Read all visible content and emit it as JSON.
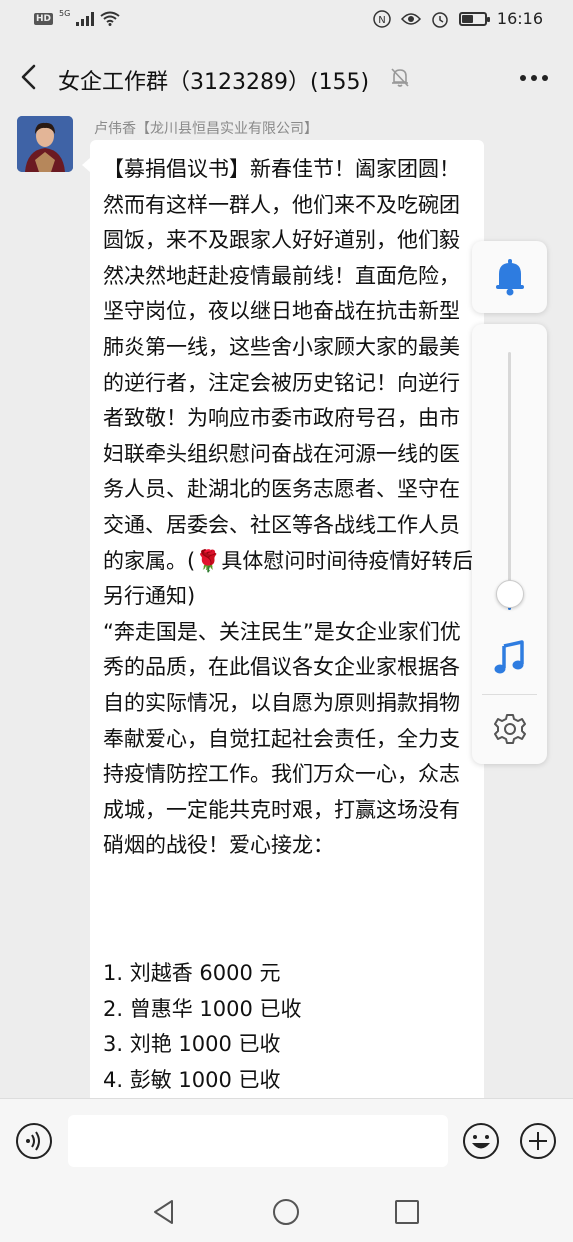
{
  "status_bar": {
    "hd": "HD",
    "network": "5G",
    "time": "16:16",
    "battery_level": 0.45
  },
  "header": {
    "title": "女企工作群（3123289）(155)"
  },
  "message": {
    "sender": "卢伟香【龙川县恒昌实业有限公司】",
    "text": "【募捐倡议书】新春佳节！阖家团圆！然而有这样一群人，他们来不及吃碗团圆饭，来不及跟家人好好道别，他们毅然决然地赶赴疫情最前线！直面危险，坚守岗位，夜以继日地奋战在抗击新型肺炎第一线，这些舍小家顾大家的最美的逆行者，注定会被历史铭记！向逆行者致敬！为响应市委市政府号召，由市妇联牵头组织慰问奋战在河源一线的医务人员、赴湖北的医务志愿者、坚守在交通、居委会、社区等各战线工作人员的家属。(🌹具体慰问时间待疫情好转后另行通知)\n“奔走国是、关注民生”是女企业家们优秀的品质，在此倡议各女企业家根据各自的实际情况，以自愿为原则捐款捐物奉献爱心，自觉扛起社会责任，全力支持疫情防控工作。我们万众一心，众志成城，一定能共克时艰，打赢这场没有硝烟的战役！爱心接龙：",
    "list": [
      "1. 刘越香 6000 元",
      "2. 曾惠华 1000 已收",
      "3. 刘艳 1000 已收",
      "4. 彭敏 1000 已收"
    ]
  },
  "float_panel": {
    "volume_level": 0.05,
    "accent_color": "#2e7ce0"
  },
  "colors": {
    "background": "#ededed",
    "bubble": "#ffffff",
    "sender": "#8a8a8a"
  }
}
